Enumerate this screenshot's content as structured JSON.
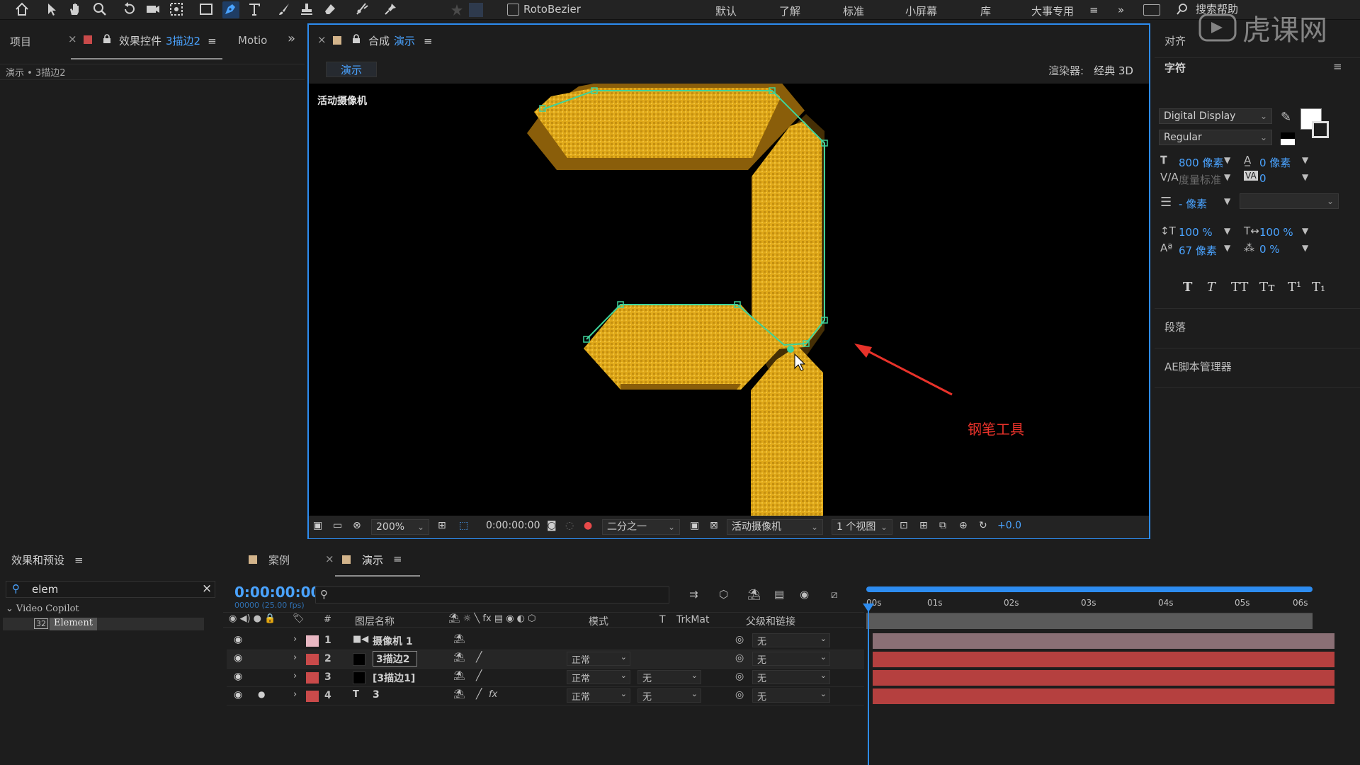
{
  "toolbar": {
    "rotobezier_label": "RotoBezier",
    "workspaces": [
      "默认",
      "了解",
      "标准",
      "小屏幕",
      "库",
      "大事专用"
    ],
    "active_workspace": "大事专用",
    "search_help": "搜索帮助",
    "tool_icons": [
      "home-icon",
      "selection-arrow-icon",
      "hand-icon",
      "zoom-icon",
      "rotate-icon",
      "camera-orbit-icon",
      "pan-behind-icon",
      "rectangle-icon",
      "pen-icon",
      "type-icon",
      "brush-icon",
      "clone-stamp-icon",
      "eraser-icon",
      "roto-brush-icon",
      "puppet-pin-icon"
    ]
  },
  "left_panel": {
    "tab_project": "项目",
    "tab_effect_controls_prefix": "效果控件",
    "tab_effect_controls_layer": "3描边2",
    "tab_motion": "Motio",
    "breadcrumb": "演示 • 3描边2"
  },
  "viewer": {
    "tab_prefix": "合成",
    "tab_name": "演示",
    "comp_tab": "演示",
    "renderer_label": "渲染器:",
    "renderer_value": "经典 3D",
    "camera_label": "活动摄像机",
    "annotation": "钢笔工具",
    "zoom": "200%",
    "timecode": "0:00:00:00",
    "resolution": "二分之一",
    "camera_select": "活动摄像机",
    "views": "1 个视图",
    "exposure": "+0.0"
  },
  "effects_panel": {
    "title": "效果和预设",
    "search_value": "elem",
    "category": "Video Copilot",
    "item": "Element"
  },
  "timeline": {
    "tabs": [
      "案例",
      "演示"
    ],
    "active_tab": "演示",
    "timecode": "0:00:00:00",
    "fps": "00000 (25.00 fps)",
    "col_hash": "#",
    "col_name": "图层名称",
    "col_mode": "模式",
    "col_t": "T",
    "col_trkmat": "TrkMat",
    "col_parent": "父级和链接",
    "ruler": [
      "00s",
      "01s",
      "02s",
      "03s",
      "04s",
      "05s",
      "06s"
    ],
    "layers": [
      {
        "num": "1",
        "name": "摄像机 1",
        "label_color": "#e8b7c2",
        "mode": "",
        "trkmat": "",
        "parent": "无",
        "type_icon": "camera-icon"
      },
      {
        "num": "2",
        "name": "3描边2",
        "label_color": "#c94a4a",
        "mode": "正常",
        "trkmat": "",
        "parent": "无",
        "type_icon": "solid-icon"
      },
      {
        "num": "3",
        "name": "[3描边1]",
        "label_color": "#c94a4a",
        "mode": "正常",
        "trkmat": "无",
        "parent": "无",
        "type_icon": "solid-icon"
      },
      {
        "num": "4",
        "name": "3",
        "label_color": "#c94a4a",
        "mode": "正常",
        "trkmat": "无",
        "parent": "无",
        "type_icon": "text-layer-icon"
      }
    ]
  },
  "right_panel": {
    "align": "对齐",
    "character": "字符",
    "font": "Digital Display",
    "style": "Regular",
    "font_size": "800 像素",
    "leading": "0 像素",
    "kerning": "度量标准",
    "tracking": "0",
    "stroke": "- 像素",
    "vscale": "100 %",
    "hscale": "100 %",
    "baseline": "67 像素",
    "tsume": "0 %",
    "type_styles": [
      "T",
      "T",
      "TT",
      "Tт",
      "T¹",
      "T₁"
    ],
    "paragraph": "段落",
    "script_manager": "AE脚本管理器"
  },
  "watermark": "虎课网",
  "colors": {
    "accent": "#2d8cf0",
    "digit_fill": "#e0a91a",
    "mask_path": "#3fd39a",
    "annotation": "#e8322a",
    "layer_red": "#c94a4a",
    "layer_pink": "#e8b7c2"
  }
}
